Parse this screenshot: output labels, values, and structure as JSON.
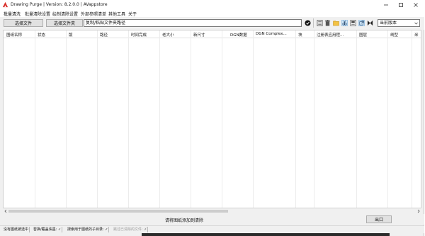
{
  "window": {
    "title": "Drawing Purge  | Version: 8.2.0.0  |   AVappstore"
  },
  "menu": {
    "items": [
      "批量清洗",
      "批量清除设置",
      "绘制清除设置",
      "外部参照清单",
      "其他工具",
      "关于"
    ]
  },
  "toolbar": {
    "select_file_label": "选择文件",
    "select_folder_label": "选择文件夹",
    "path_placeholder": "复制/粘贴文件夹路径",
    "version_value": "当前版本",
    "icons": [
      "confirm-icon",
      "tool-icon-1",
      "tool-icon-2",
      "folder-icon",
      "tool-icon-4",
      "tool-icon-5",
      "external-link-icon",
      "bowtie-icon"
    ]
  },
  "grid": {
    "columns": [
      "图纸名称",
      "状态",
      "版",
      "路径",
      "时间完成",
      "老大小",
      "新尺寸",
      "DGN数据",
      "DGN Complex...",
      "块",
      "注册表应用程...",
      "图层",
      "线型",
      "米"
    ]
  },
  "bottom": {
    "add_label": "请将图纸添加到清除",
    "exit_label": "出口"
  },
  "status": {
    "items": [
      {
        "label": "没有图纸被选中",
        "enabled": true
      },
      {
        "label": "替换/覆盖油墨: ✓",
        "enabled": true
      },
      {
        "label": "搜索用于图纸的子目录: ✓",
        "enabled": true
      },
      {
        "label": "跳过已清除的文件: ✗",
        "enabled": false
      }
    ]
  },
  "colors": {
    "accent": "#0078d7",
    "app_icon_red": "#d9302b",
    "status_disabled": "#9a9a9a"
  }
}
